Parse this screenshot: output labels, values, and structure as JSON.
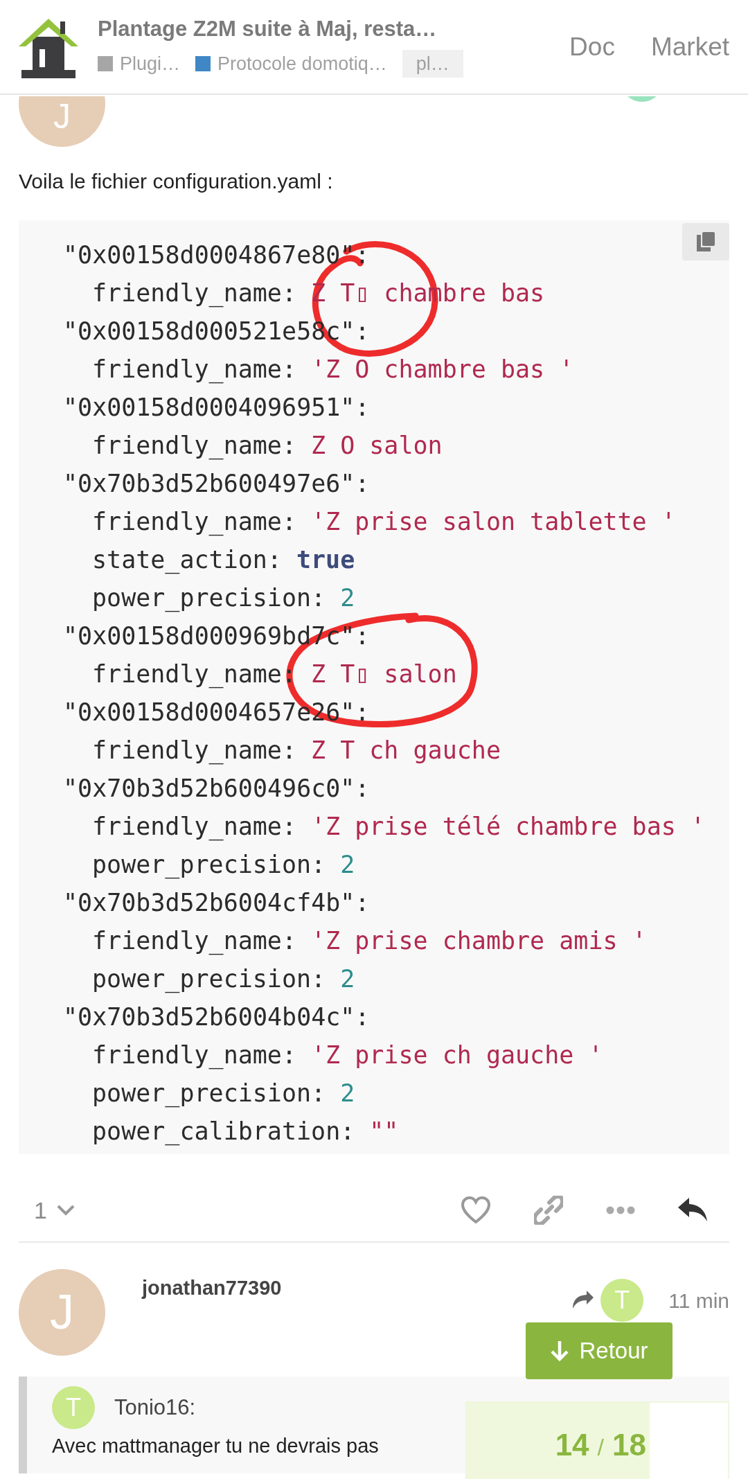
{
  "header": {
    "title": "Plantage Z2M suite à Maj, resta…",
    "categories": [
      {
        "label": "Plugi…",
        "color": "#a6a6a6"
      },
      {
        "label": "Protocole domotiq…",
        "color": "#3f88c5"
      }
    ],
    "tag": "pl…",
    "nav": [
      "Doc",
      "Market"
    ]
  },
  "post": {
    "avatar_letter": "J",
    "text": "Voila le fichier configuration.yaml :",
    "code": [
      {
        "id": "\"0x00158d0004867e80\":",
        "fields": [
          {
            "key": "friendly_name:",
            "value": "Z T▯ chambre bas",
            "kind": "string"
          }
        ]
      },
      {
        "id": "\"0x00158d000521e58c\":",
        "fields": [
          {
            "key": "friendly_name:",
            "value": "'Z O chambre bas '",
            "kind": "string"
          }
        ]
      },
      {
        "id": "\"0x00158d0004096951\":",
        "fields": [
          {
            "key": "friendly_name:",
            "value": "Z O salon",
            "kind": "string"
          }
        ]
      },
      {
        "id": "\"0x70b3d52b600497e6\":",
        "fields": [
          {
            "key": "friendly_name:",
            "value": "'Z prise salon tablette '",
            "kind": "string"
          },
          {
            "key": "state_action:",
            "value": "true",
            "kind": "bool"
          },
          {
            "key": "power_precision:",
            "value": "2",
            "kind": "number"
          }
        ]
      },
      {
        "id": "\"0x00158d000969bd7c\":",
        "fields": [
          {
            "key": "friendly_name:",
            "value": "Z T▯ salon",
            "kind": "string"
          }
        ]
      },
      {
        "id": "\"0x00158d0004657e26\":",
        "fields": [
          {
            "key": "friendly_name:",
            "value": "Z T ch gauche",
            "kind": "string"
          }
        ]
      },
      {
        "id": "\"0x70b3d52b600496c0\":",
        "fields": [
          {
            "key": "friendly_name:",
            "value": "'Z prise télé chambre bas '",
            "kind": "string"
          },
          {
            "key": "power_precision:",
            "value": "2",
            "kind": "number"
          }
        ]
      },
      {
        "id": "\"0x70b3d52b6004cf4b\":",
        "fields": [
          {
            "key": "friendly_name:",
            "value": "'Z prise chambre amis '",
            "kind": "string"
          },
          {
            "key": "power_precision:",
            "value": "2",
            "kind": "number"
          }
        ]
      },
      {
        "id": "\"0x70b3d52b6004b04c\":",
        "fields": [
          {
            "key": "friendly_name:",
            "value": "'Z prise ch gauche '",
            "kind": "string"
          },
          {
            "key": "power_precision:",
            "value": "2",
            "kind": "number"
          },
          {
            "key": "power_calibration:",
            "value": "\"\"",
            "kind": "string"
          }
        ]
      }
    ],
    "like_count": "1"
  },
  "reply": {
    "avatar_letter": "J",
    "username": "jonathan77390",
    "reply_to_letter": "T",
    "time": "11 min",
    "quote_letter": "T",
    "quote_author": "Tonio16:",
    "quote_text": "Avec mattmanager tu ne devrais pas"
  },
  "back_button": "Retour",
  "progress": {
    "current": "14",
    "separator": "/",
    "total": "18",
    "level": 0.7
  }
}
